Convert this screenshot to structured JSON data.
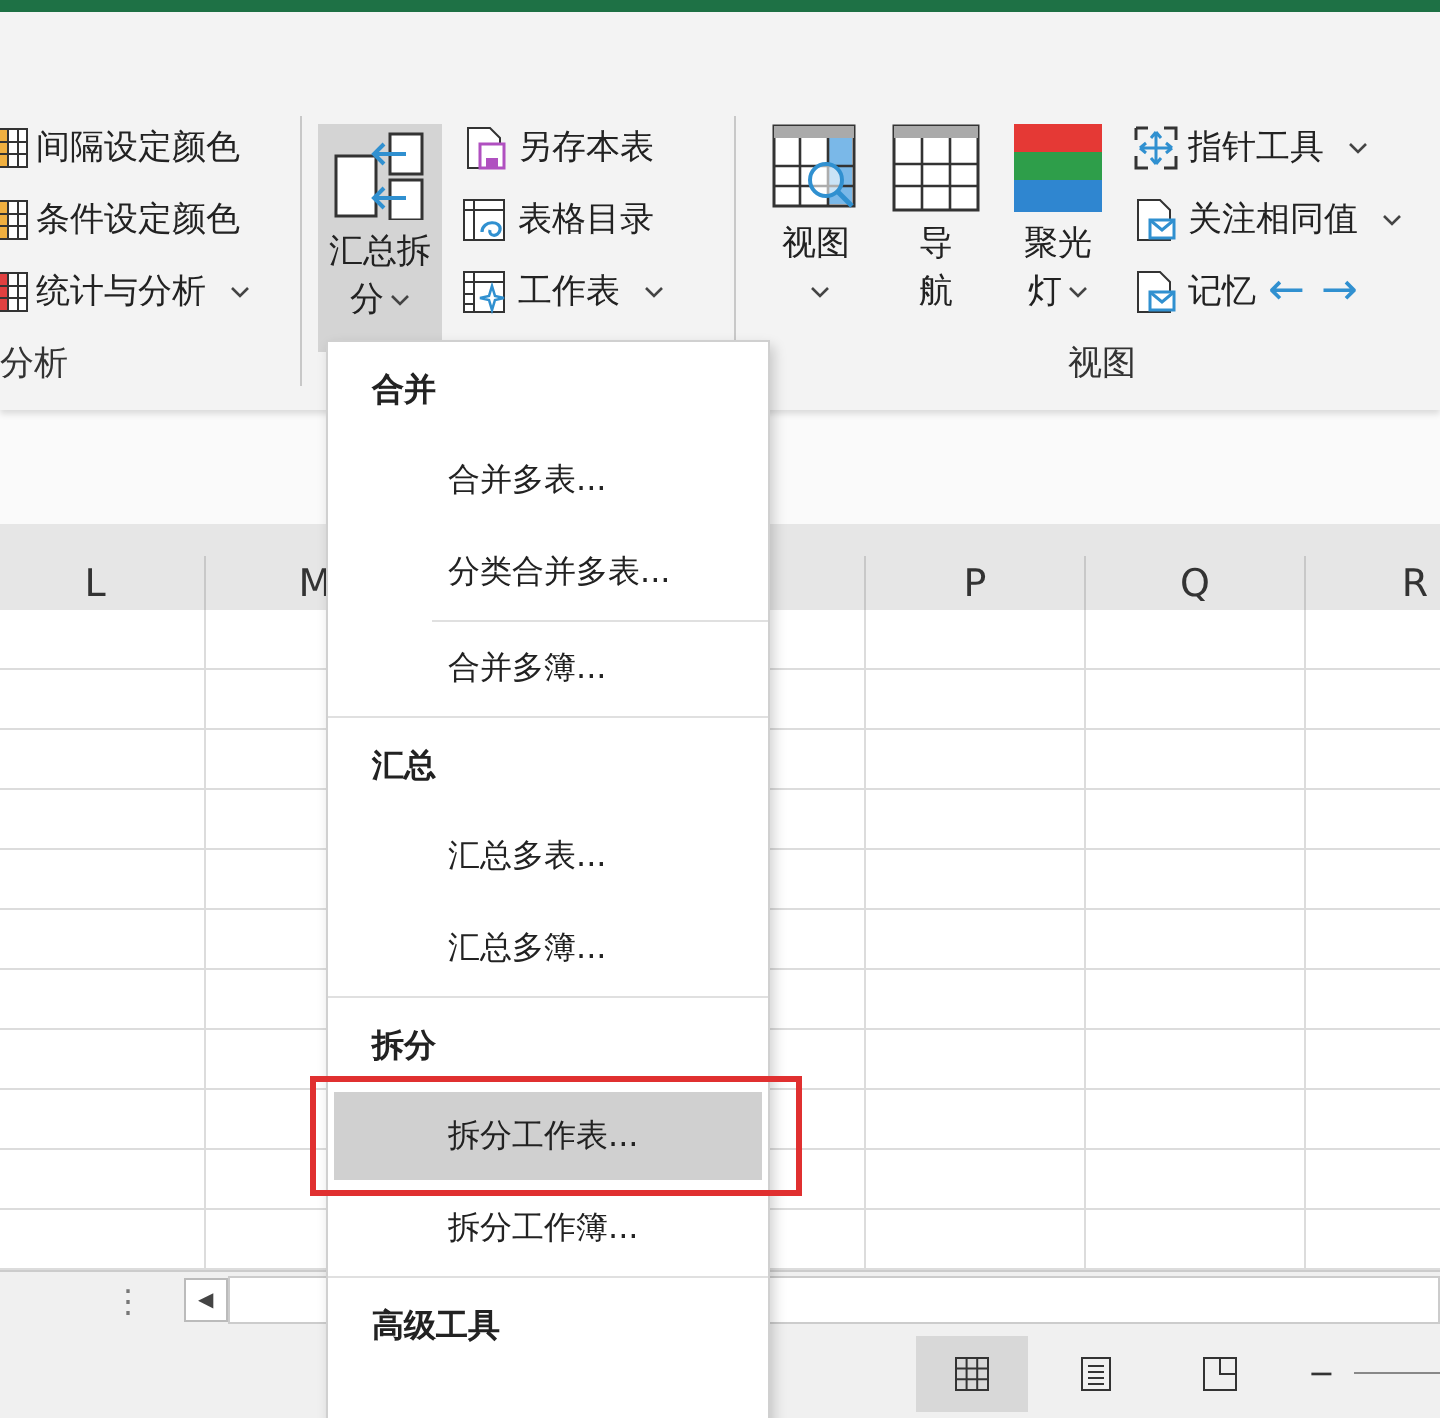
{
  "ribbon": {
    "groups": [
      {
        "label": "分析",
        "items": [
          {
            "label": "间隔设定颜色",
            "dropdown": false
          },
          {
            "label": "条件设定颜色",
            "dropdown": false
          },
          {
            "label": "统计与分析",
            "dropdown": true
          }
        ]
      },
      {
        "big": [
          {
            "label": "汇总拆分",
            "dropdown": true,
            "open": true
          }
        ],
        "items": [
          {
            "label": "另存本表",
            "dropdown": false
          },
          {
            "label": "表格目录",
            "dropdown": false
          },
          {
            "label": "工作表",
            "dropdown": true
          }
        ]
      },
      {
        "label": "视图",
        "big": [
          {
            "label": "视图",
            "dropdown": true,
            "open": false
          },
          {
            "label": "导航",
            "dropdown": false,
            "open": false
          },
          {
            "label": "聚光灯",
            "dropdown": true,
            "open": false
          }
        ],
        "items": [
          {
            "label": "指针工具",
            "dropdown": true
          },
          {
            "label": "关注相同值",
            "dropdown": true
          },
          {
            "label": "记忆",
            "dropdown": false,
            "arrows": [
              "←",
              "→"
            ]
          }
        ]
      }
    ]
  },
  "sheet": {
    "columns": [
      {
        "label": "L"
      },
      {
        "label": "M"
      },
      {},
      {},
      {
        "label": "P"
      },
      {
        "label": "Q"
      },
      {
        "label": "R"
      }
    ]
  },
  "sheet_bar": {
    "more": "⋮",
    "prev": "◀"
  },
  "status_bar": {
    "views": [
      {
        "selected": true
      },
      {
        "selected": false
      },
      {
        "selected": false
      }
    ],
    "zoom_out": "−"
  },
  "menu": {
    "sections": [
      {
        "header": "合并",
        "items": [
          {
            "kind": "item",
            "label": "合并多表...",
            "selected": false
          },
          {
            "kind": "item",
            "label": "分类合并多表...",
            "selected": false
          },
          {
            "kind": "separator"
          },
          {
            "kind": "item",
            "label": "合并多簿...",
            "selected": false
          }
        ]
      },
      {
        "header": "汇总",
        "items": [
          {
            "kind": "item",
            "label": "汇总多表...",
            "selected": false
          },
          {
            "kind": "item",
            "label": "汇总多簿...",
            "selected": false
          }
        ]
      },
      {
        "header": "拆分",
        "items": [
          {
            "kind": "item",
            "label": "拆分工作表...",
            "selected": true
          },
          {
            "kind": "item",
            "label": "拆分工作簿...",
            "selected": false
          }
        ]
      },
      {
        "header": "高级工具"
      }
    ]
  }
}
